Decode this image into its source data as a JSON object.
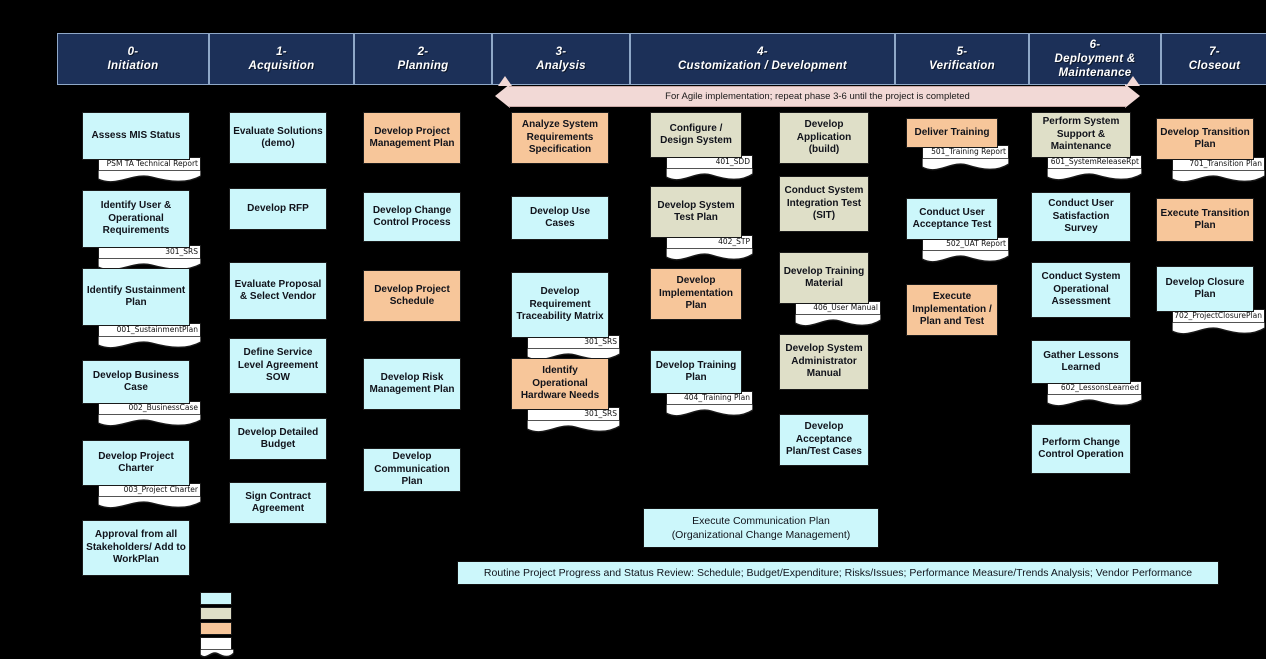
{
  "colors": {
    "header_bg": "#1c3058",
    "header_text": "#ffffff",
    "cyan": "#ccf7fb",
    "khaki": "#dfdfc8",
    "peach": "#f7c69a",
    "banner": "#f2d9d6",
    "background": "#000000"
  },
  "phases": [
    {
      "number": "0-",
      "name": "Initiation"
    },
    {
      "number": "1-",
      "name": "Acquisition"
    },
    {
      "number": "2-",
      "name": "Planning"
    },
    {
      "number": "3-",
      "name": "Analysis"
    },
    {
      "number": "4-",
      "name": "Customization / Development"
    },
    {
      "number": "5-",
      "name": "Verification"
    },
    {
      "number": "6-",
      "name": "Deployment & Maintenance"
    },
    {
      "number": "7-",
      "name": "Closeout"
    }
  ],
  "agile_banner": {
    "text": "For Agile implementation; repeat phase 3-6 until the project is completed"
  },
  "tasks": {
    "initiation": [
      {
        "label": "Assess MIS Status",
        "color": "cyan",
        "doc": "PSM TA Technical Report"
      },
      {
        "label": "Identify User & Operational Requirements",
        "color": "cyan",
        "doc": "301_SRS"
      },
      {
        "label": "Identify Sustainment Plan",
        "color": "cyan",
        "doc": "001_SustainmentPlan"
      },
      {
        "label": "Develop Business Case",
        "color": "cyan",
        "doc": "002_BusinessCase"
      },
      {
        "label": "Develop Project Charter",
        "color": "cyan",
        "doc": "003_Project Charter"
      },
      {
        "label": "Approval from all Stakeholders/ Add to WorkPlan",
        "color": "cyan",
        "doc": null
      }
    ],
    "acquisition": [
      {
        "label": "Evaluate Solutions (demo)",
        "color": "cyan",
        "doc": null
      },
      {
        "label": "Develop RFP",
        "color": "cyan",
        "doc": null
      },
      {
        "label": "Evaluate Proposal & Select Vendor",
        "color": "cyan",
        "doc": null
      },
      {
        "label": "Define Service Level Agreement SOW",
        "color": "cyan",
        "doc": null
      },
      {
        "label": "Develop Detailed Budget",
        "color": "cyan",
        "doc": null
      },
      {
        "label": "Sign Contract Agreement",
        "color": "cyan",
        "doc": null
      }
    ],
    "planning": [
      {
        "label": "Develop Project Management Plan",
        "color": "peach",
        "doc": null
      },
      {
        "label": "Develop Change Control Process",
        "color": "cyan",
        "doc": null
      },
      {
        "label": "Develop Project Schedule",
        "color": "peach",
        "doc": null
      },
      {
        "label": "Develop Risk Management Plan",
        "color": "cyan",
        "doc": null
      },
      {
        "label": "Develop Communication Plan",
        "color": "cyan",
        "doc": null
      }
    ],
    "analysis": [
      {
        "label": "Analyze System Requirements Specification",
        "color": "peach",
        "doc": null
      },
      {
        "label": "Develop Use Cases",
        "color": "cyan",
        "doc": null
      },
      {
        "label": "Develop Requirement Traceability Matrix",
        "color": "cyan",
        "doc": "301_SRS"
      },
      {
        "label": "Identify Operational Hardware Needs",
        "color": "peach",
        "doc": "301_SRS"
      }
    ],
    "customization_a": [
      {
        "label": "Configure / Design System",
        "color": "khaki",
        "doc": "401_SDD"
      },
      {
        "label": "Develop System Test Plan",
        "color": "khaki",
        "doc": "402_STP"
      },
      {
        "label": "Develop Implementation Plan",
        "color": "peach",
        "doc": null
      },
      {
        "label": "Develop Training Plan",
        "color": "cyan",
        "doc": "404_Training Plan"
      }
    ],
    "customization_b": [
      {
        "label": "Develop Application (build)",
        "color": "khaki",
        "doc": null
      },
      {
        "label": "Conduct System Integration Test (SIT)",
        "color": "khaki",
        "doc": null
      },
      {
        "label": "Develop Training Material",
        "color": "khaki",
        "doc": "406_User Manual"
      },
      {
        "label": "Develop System Administrator Manual",
        "color": "khaki",
        "doc": null
      },
      {
        "label": "Develop Acceptance Plan/Test Cases",
        "color": "cyan",
        "doc": null
      }
    ],
    "verification": [
      {
        "label": "Deliver Training",
        "color": "peach",
        "doc": "501_Training Report"
      },
      {
        "label": "Conduct User Acceptance Test",
        "color": "cyan",
        "doc": "502_UAT Report"
      },
      {
        "label": "Execute Implementation / Plan and Test",
        "color": "peach",
        "doc": null
      }
    ],
    "deployment": [
      {
        "label": "Perform System Support & Maintenance",
        "color": "khaki",
        "doc": "601_SystemReleaseRpt"
      },
      {
        "label": "Conduct User Satisfaction Survey",
        "color": "cyan",
        "doc": null
      },
      {
        "label": "Conduct System Operational Assessment",
        "color": "cyan",
        "doc": null
      },
      {
        "label": "Gather Lessons Learned",
        "color": "cyan",
        "doc": "602_LessonsLearned"
      },
      {
        "label": "Perform Change Control Operation",
        "color": "cyan",
        "doc": null
      }
    ],
    "closeout": [
      {
        "label": "Develop Transition Plan",
        "color": "peach",
        "doc": "701_Transition Plan"
      },
      {
        "label": "Execute Transition Plan",
        "color": "peach",
        "doc": null
      },
      {
        "label": "Develop Closure Plan",
        "color": "cyan",
        "doc": "702_ProjectClosurePlan"
      }
    ]
  },
  "bottom_bars": [
    {
      "line1": "Execute Communication Plan",
      "line2": "(Organizational Change Management)"
    },
    {
      "line1": "Routine Project Progress and Status Review:   Schedule; Budget/Expenditure; Risks/Issues; Performance Measure/Trends Analysis; Vendor Performance",
      "line2": ""
    }
  ],
  "legend": [
    {
      "swatch": "cyan"
    },
    {
      "swatch": "khaki"
    },
    {
      "swatch": "peach"
    },
    {
      "swatch": "document"
    }
  ]
}
